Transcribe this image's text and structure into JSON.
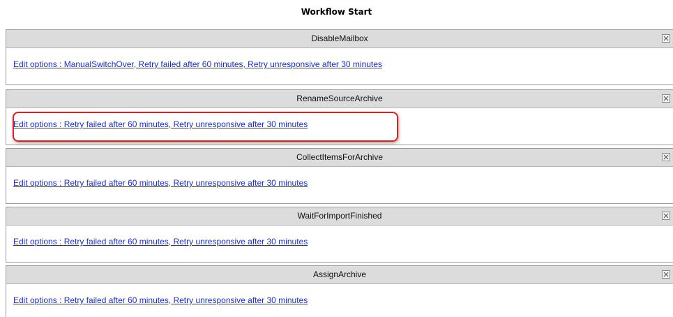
{
  "page": {
    "title": "Workflow Start"
  },
  "steps": [
    {
      "name": "DisableMailbox",
      "options_link": "Edit options : ManualSwitchOver, Retry failed after 60 minutes, Retry unresponsive after 30 minutes"
    },
    {
      "name": "RenameSourceArchive",
      "options_link": "Edit options : Retry failed after 60 minutes, Retry unresponsive after 30 minutes",
      "highlighted": true
    },
    {
      "name": "CollectItemsForArchive",
      "options_link": "Edit options : Retry failed after 60 minutes, Retry unresponsive after 30 minutes"
    },
    {
      "name": "WaitForImportFinished",
      "options_link": "Edit options : Retry failed after 60 minutes, Retry unresponsive after 30 minutes"
    },
    {
      "name": "AssignArchive",
      "options_link": "Edit options : Retry failed after 60 minutes, Retry unresponsive after 30 minutes"
    }
  ],
  "colors": {
    "link": "#1a2fcf",
    "header_bg": "#dcdcdc",
    "highlight_border": "#e02020"
  }
}
